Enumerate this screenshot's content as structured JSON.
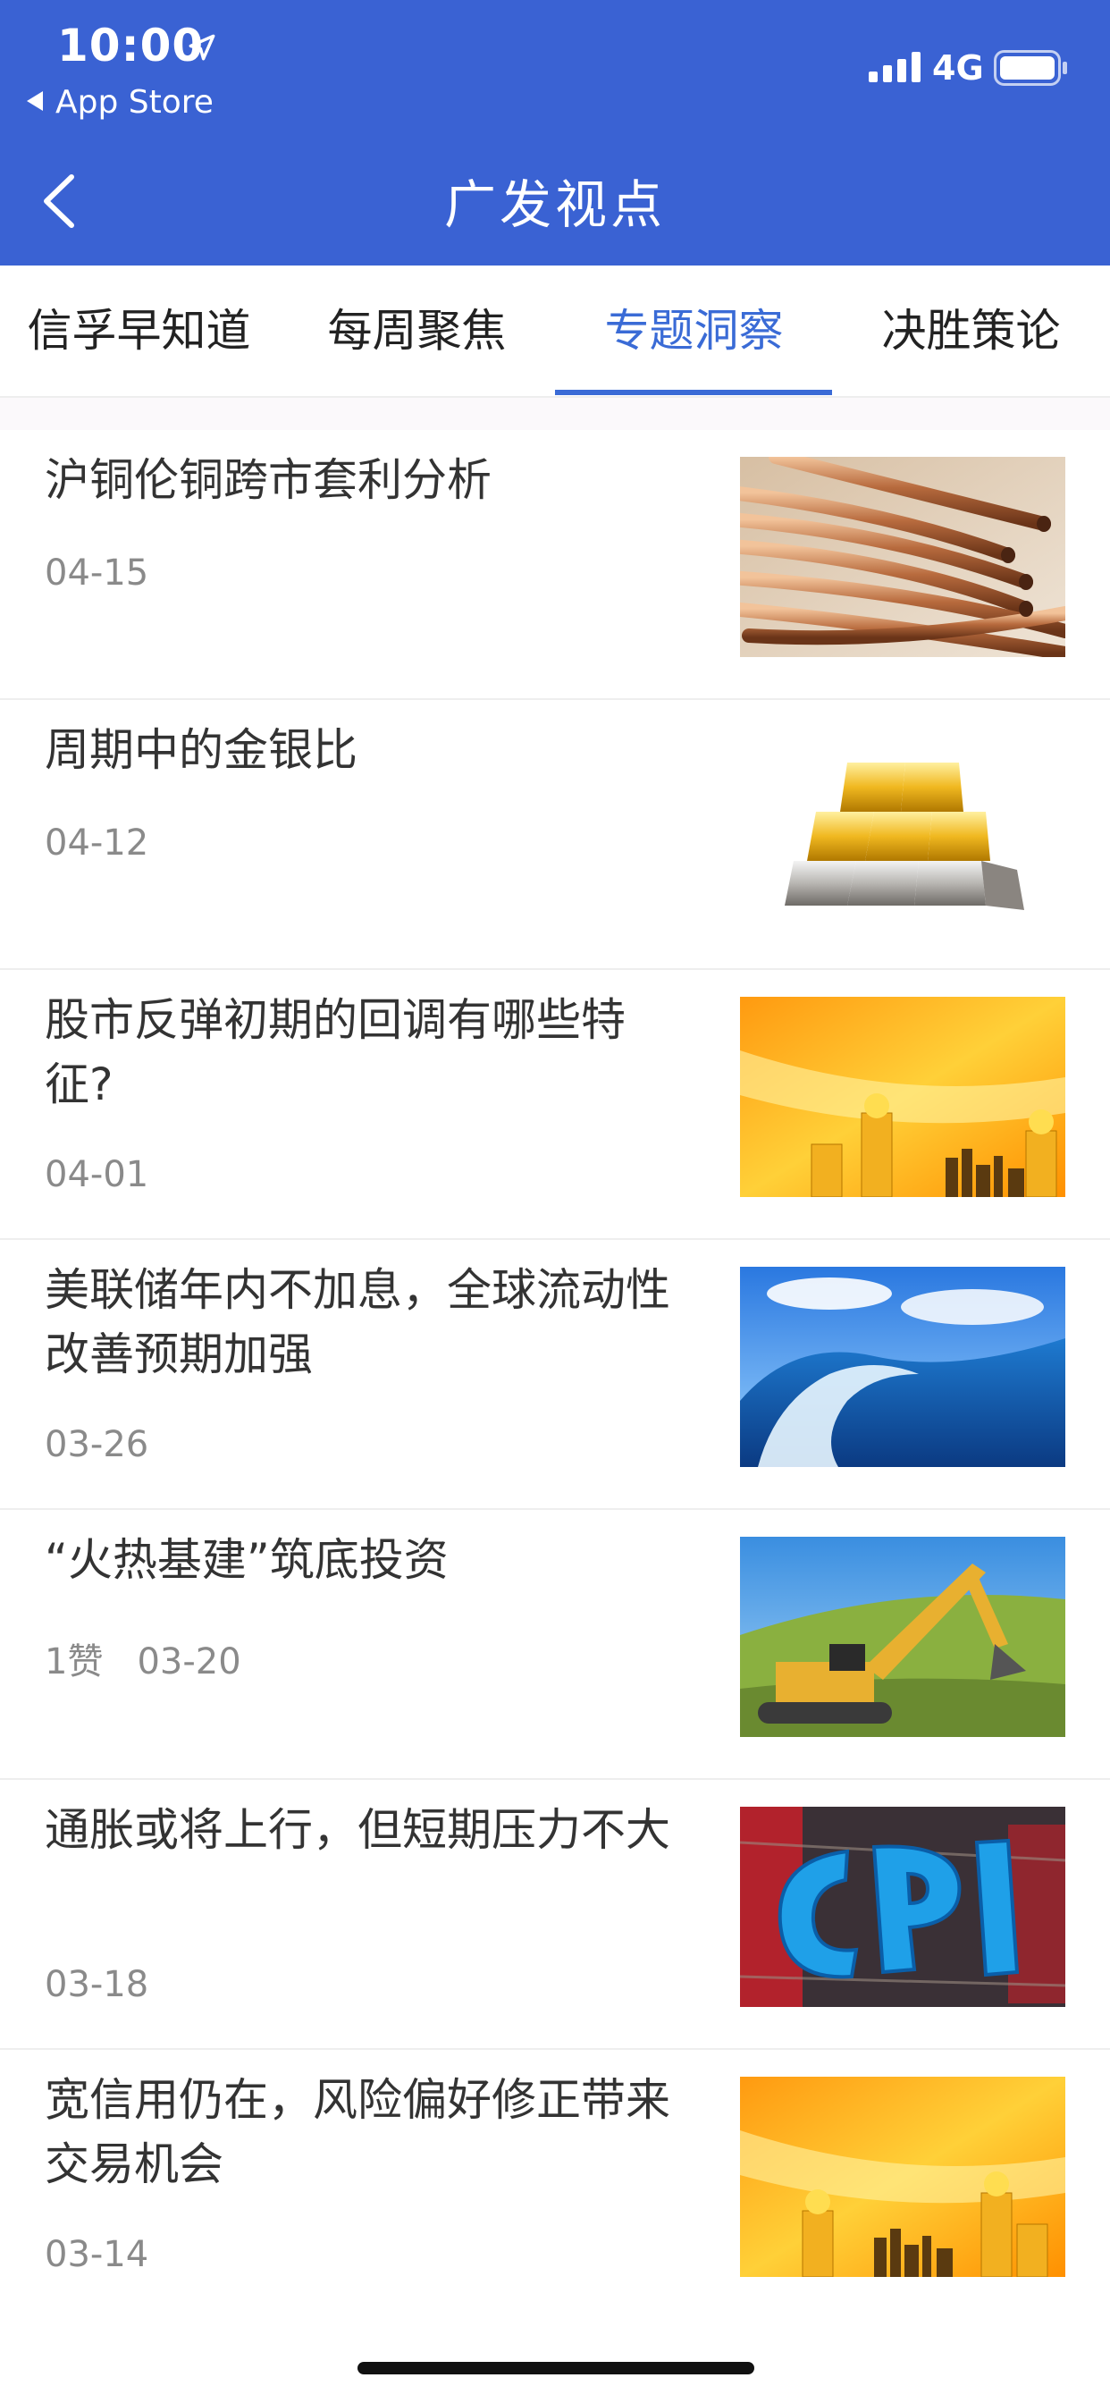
{
  "status_bar": {
    "time": "10:00",
    "back_app": "App Store",
    "network": "4G"
  },
  "nav": {
    "title": "广发视点"
  },
  "tabs": [
    {
      "label": "信孚早知道",
      "active": false
    },
    {
      "label": "每周聚焦",
      "active": false
    },
    {
      "label": "专题洞察",
      "active": true
    },
    {
      "label": "决胜策论",
      "active": false
    }
  ],
  "articles": [
    {
      "title": "沪铜伦铜跨市套利分析",
      "date": "04-15",
      "likes": "",
      "thumb": "copper-pipes-image"
    },
    {
      "title": "周期中的金银比",
      "date": "04-12",
      "likes": "",
      "thumb": "gold-bars-image"
    },
    {
      "title": "股市反弹初期的回调有哪些特征?",
      "date": "04-01",
      "likes": "",
      "thumb": "golden-city-coins-image"
    },
    {
      "title": "美联储年内不加息，全球流动性改善预期加强",
      "date": "03-26",
      "likes": "",
      "thumb": "ocean-wave-image"
    },
    {
      "title": "“火热基建”筑底投资",
      "date": "03-20",
      "likes": "1赞",
      "thumb": "excavator-image"
    },
    {
      "title": "通胀或将上行，但短期压力不大",
      "date": "03-18",
      "likes": "",
      "thumb": "cpi-letters-image"
    },
    {
      "title": "宽信用仍在，风险偏好修正带来交易机会",
      "date": "03-14",
      "likes": "",
      "thumb": "golden-city-coins-image"
    }
  ],
  "colors": {
    "brand": "#3a62d3",
    "tab_active": "#3a6bd6",
    "title_text": "#333333",
    "meta_text": "#8a8a8a"
  }
}
